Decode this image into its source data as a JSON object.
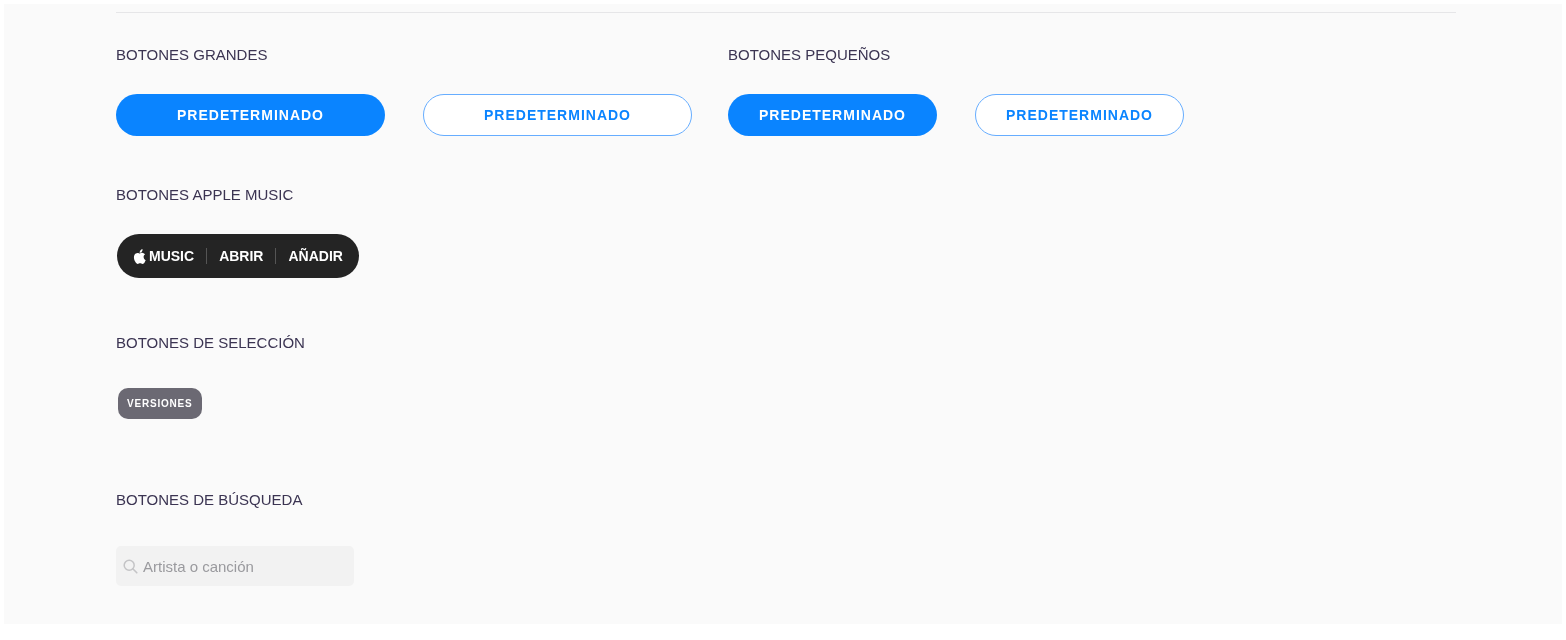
{
  "button_groups": [
    {
      "heading": "BOTONES GRANDES",
      "kind": "large",
      "buttons": [
        {
          "label": "PREDETERMINADO",
          "kind": "filled"
        },
        {
          "label": "PREDETERMINADO",
          "kind": "outline"
        }
      ]
    },
    {
      "heading": "BOTONES PEQUEÑOS",
      "kind": "small",
      "buttons": [
        {
          "label": "PREDETERMINADO",
          "kind": "filled"
        },
        {
          "label": "PREDETERMINADO",
          "kind": "outline"
        }
      ]
    }
  ],
  "apple_music": {
    "heading": "BOTONES APPLE MUSIC",
    "brand_label": "MUSIC",
    "actions": [
      "ABRIR",
      "AÑADIR"
    ]
  },
  "selection": {
    "heading": "BOTONES DE SELECCIÓN",
    "chips": [
      "VERSIONES"
    ]
  },
  "search": {
    "heading": "BOTONES DE BÚSQUEDA",
    "placeholder": "Artista o canción"
  }
}
